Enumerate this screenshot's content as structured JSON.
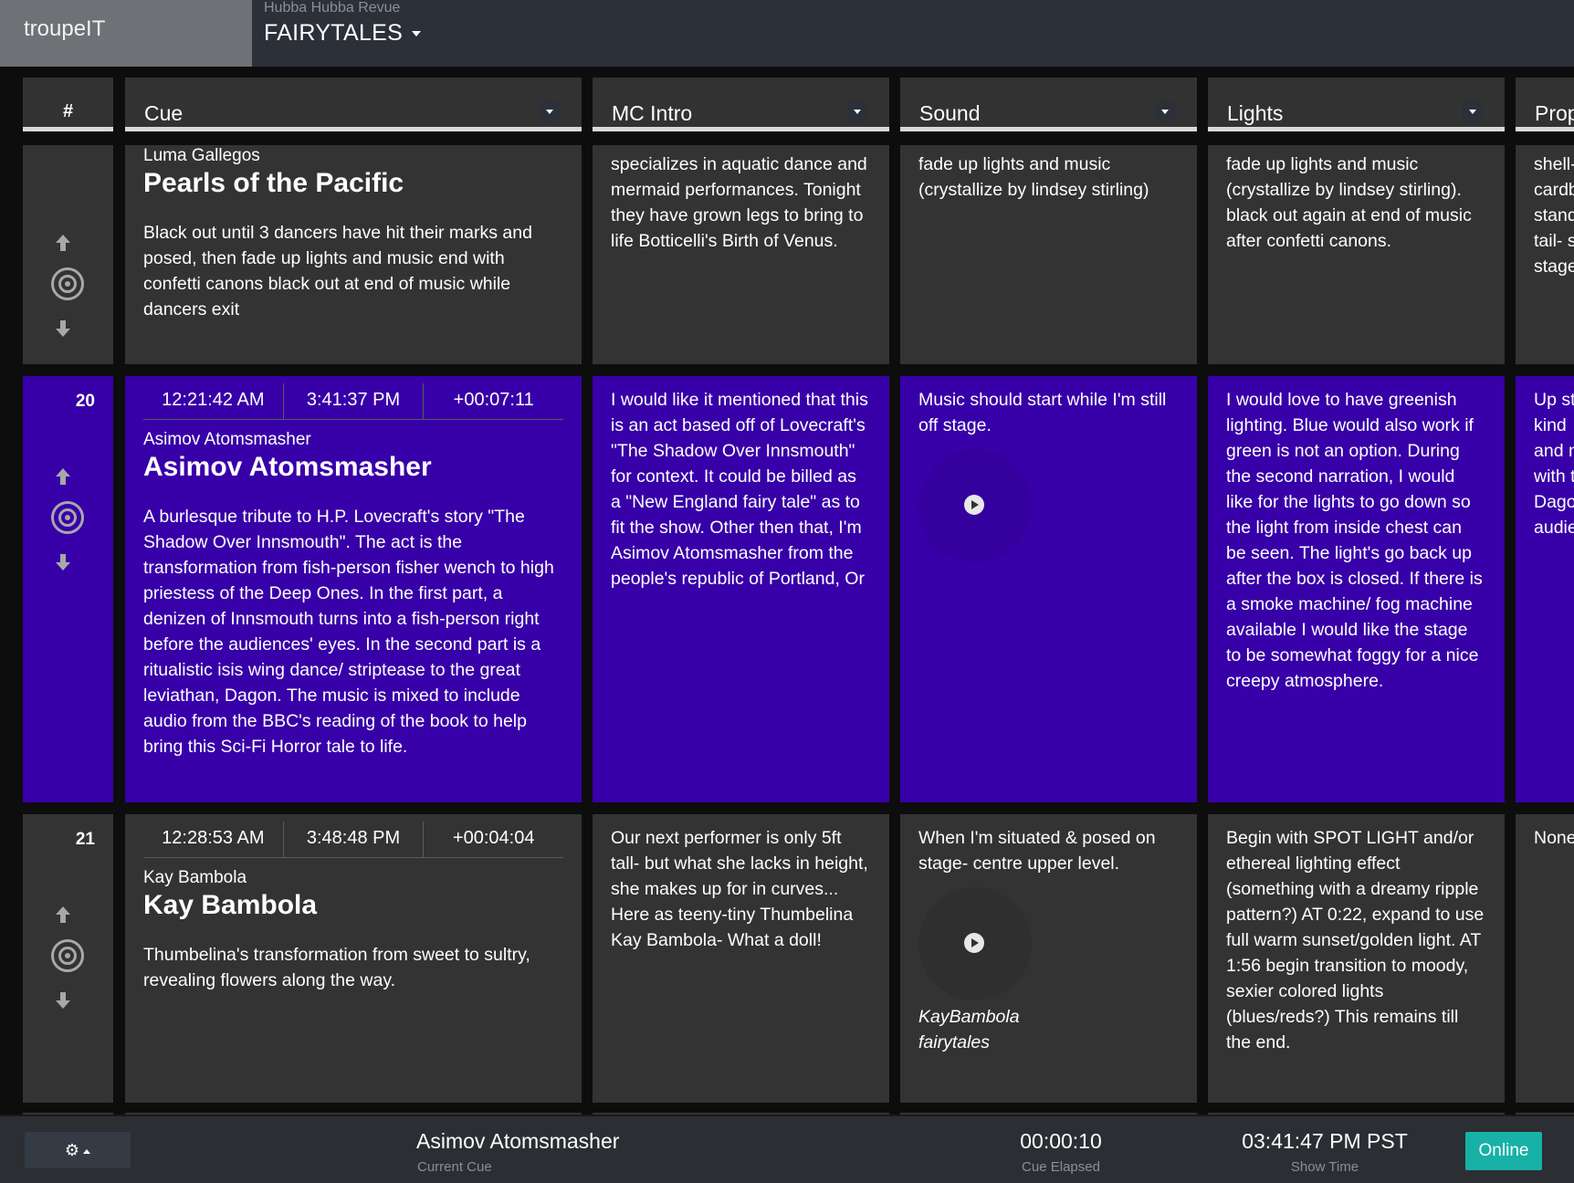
{
  "app": {
    "brand": "troupeIT"
  },
  "show": {
    "subtitle": "Hubba Hubba Revue",
    "title": "FAIRYTALES"
  },
  "columns": [
    "#",
    "Cue",
    "MC Intro",
    "Sound",
    "Lights",
    "Prop"
  ],
  "rows": [
    {
      "number": "",
      "performer": "Luma Gallegos",
      "act": "Pearls of the Pacific",
      "description": "Black out until 3 dancers have hit their marks and posed, then fade up lights and music end with confetti canons black out at end of music while dancers exit",
      "mc_intro": "specializes in aquatic dance and mermaid performances. Tonight they have grown legs to bring to life Botticelli's Birth of Venus.",
      "sound": "fade up lights and music (crystallize by lindsey stirling)",
      "lights": "fade up lights and music (crystallize by lindsey stirling). black out again at end of music after confetti canons.",
      "props": "shell-\ncardb\nstand\ntail- s\nstage"
    },
    {
      "number": "20",
      "times": [
        "12:21:42 AM",
        "3:41:37 PM",
        "+00:07:11"
      ],
      "performer": "Asimov Atomsmasher",
      "act": "Asimov Atomsmasher",
      "description": "A burlesque tribute to H.P. Lovecraft's story \"The Shadow Over Innsmouth\". The act is the transformation from fish-person fisher wench to high priestess of the Deep Ones. In the first part, a denizen of Innsmouth turns into a fish-person right before the audiences' eyes. In the second part is a ritualistic isis wing dance/ striptease to the great leviathan, Dagon. The music is mixed to include audio from the BBC's reading of the book to help bring this Sci-Fi Horror tale to life.",
      "mc_intro": "I would like it mentioned that this is an act based off of Lovecraft's \"The Shadow Over Innsmouth\" for context. It could be billed as a \"New England fairy tale\" as to fit the show. Other then that, I'm Asimov Atomsmasher from the people's republic of Portland, Or",
      "sound": "Music should start while I'm still off stage.",
      "lights": "I would love to have greenish lighting. Blue would also work if green is not an option. During the second narration, I would like for the lights to go down so the light from inside chest can be seen. The light's go back up after the box is closed. If there is a smoke machine/ fog machine available I would like the stage to be somewhat foggy for a nice creepy atmosphere.",
      "props": "Up st\nkind \nand n\nwith t\nDago\naudie"
    },
    {
      "number": "21",
      "times": [
        "12:28:53 AM",
        "3:48:48 PM",
        "+00:04:04"
      ],
      "performer": "Kay Bambola",
      "act": "Kay Bambola",
      "description": "Thumbelina's transformation from sweet to sultry, revealing flowers along the way.",
      "mc_intro": "Our next performer is only 5ft tall- but what she lacks in height, she makes up for in curves... Here as teeny-tiny Thumbelina Kay Bambola- What a doll!",
      "sound": "When I'm situated & posed on stage- centre upper level.",
      "track": "KayBambola\nfairytales",
      "lights": "Begin with SPOT LIGHT and/or ethereal lighting effect (something with a dreamy ripple pattern?) AT 0:22, expand to use full warm sunset/golden light. AT 1:56 begin transition to moody, sexier colored lights (blues/reds?) This remains till the end.",
      "props": "None"
    }
  ],
  "footer": {
    "current_cue": "Asimov Atomsmasher",
    "current_cue_label": "Current Cue",
    "cue_elapsed": "00:00:10",
    "cue_elapsed_label": "Cue Elapsed",
    "show_time": "03:41:47 PM PST",
    "show_time_label": "Show Time",
    "status": "Online"
  },
  "colors": {
    "active_row": "#3800a8",
    "cell": "#333333",
    "online": "#17b1a8",
    "topbar": "#2b3039"
  }
}
